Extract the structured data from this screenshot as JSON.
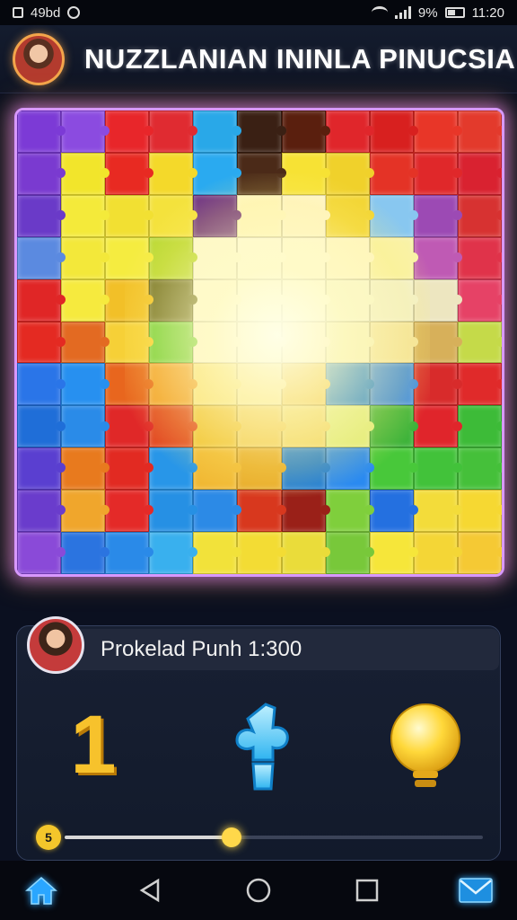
{
  "status_bar": {
    "left_text": "49bd",
    "battery_percent": "9%",
    "time": "11:20"
  },
  "header": {
    "title": "NUZZLANIAN ININLA PINUCSIA"
  },
  "board": {
    "colors": [
      [
        "#7c3ad6",
        "#8b4be0",
        "#e8262a",
        "#e02b31",
        "#29a8e8",
        "#3a2014",
        "#5a1f0e",
        "#e0262b",
        "#d8201f",
        "#e83628",
        "#e33a2c"
      ],
      [
        "#7a3ad0",
        "#f2e52b",
        "#e82a22",
        "#f4d92a",
        "#2aaaf0",
        "#4b2a18",
        "#f7e234",
        "#f0d12b",
        "#e43326",
        "#e0282a",
        "#d92230"
      ],
      [
        "#6a3ac8",
        "#f4ea3a",
        "#f2e032",
        "#f4e23c",
        "#6a2d85",
        "#fff7c8",
        "#fff6d0",
        "#f2d431",
        "#88c7f0",
        "#9c4ab4",
        "#d73231"
      ],
      [
        "#5b8ae0",
        "#f3e83a",
        "#f5ec40",
        "#b8d832",
        "#fdfbe0",
        "#fffde8",
        "#fffbe0",
        "#fff8d0",
        "#f9f2a8",
        "#bf5ab4",
        "#e0334a"
      ],
      [
        "#e02626",
        "#f6ea3e",
        "#f2c028",
        "#6a6a28",
        "#fffce4",
        "#fffff2",
        "#fffeee",
        "#f8f8d8",
        "#f2f1d2",
        "#ede6c0",
        "#e64266"
      ],
      [
        "#e42a22",
        "#e36a22",
        "#f6d037",
        "#6bcf3a",
        "#fff9e0",
        "#fffcea",
        "#fff6d8",
        "#f6f2c0",
        "#f3e3a2",
        "#d7b05a",
        "#c5da49"
      ],
      [
        "#2a75e8",
        "#2790f0",
        "#e8661e",
        "#f2a030",
        "#f9e07a",
        "#fae595",
        "#f0c44c",
        "#1b7fd8",
        "#3a8ae6",
        "#d82b2b",
        "#e02a2a"
      ],
      [
        "#1f6ed8",
        "#2a8be8",
        "#e02828",
        "#e24822",
        "#f0c238",
        "#f2cc5a",
        "#f1d66a",
        "#e0ed84",
        "#3eb33a",
        "#e0252b",
        "#3dbb38"
      ],
      [
        "#5a3fd0",
        "#e87a1e",
        "#e22a22",
        "#2896e8",
        "#f1b833",
        "#e8aa28",
        "#1a7ad8",
        "#2a8af0",
        "#48c83a",
        "#42c23a",
        "#45c03a"
      ],
      [
        "#6a3ccc",
        "#f0a62c",
        "#e42a28",
        "#2690e4",
        "#2c8ae6",
        "#d8381e",
        "#9a2018",
        "#7fcf3c",
        "#2470e0",
        "#f3dc3a",
        "#f6d832"
      ],
      [
        "#8a4ad8",
        "#2b74e0",
        "#2a8ae8",
        "#39b0ee",
        "#f2e23a",
        "#f3dc34",
        "#eadc3a",
        "#78c83a",
        "#f6e63a",
        "#f4d636",
        "#f5c934"
      ]
    ]
  },
  "panel": {
    "score_text": "Prokelad Punh 1:300",
    "slider_badge": "5",
    "slider_value": 0.4
  },
  "icons": {
    "header_search": "search-icon",
    "tool_number": "number-one-icon",
    "tool_piece": "puzzle-piece-hint-icon",
    "tool_hint": "lightbulb-icon",
    "nav_home": "home-icon",
    "nav_back": "back-icon",
    "nav_home_circle": "home-circle-icon",
    "nav_recent": "recent-apps-icon",
    "nav_mail": "mail-icon"
  }
}
